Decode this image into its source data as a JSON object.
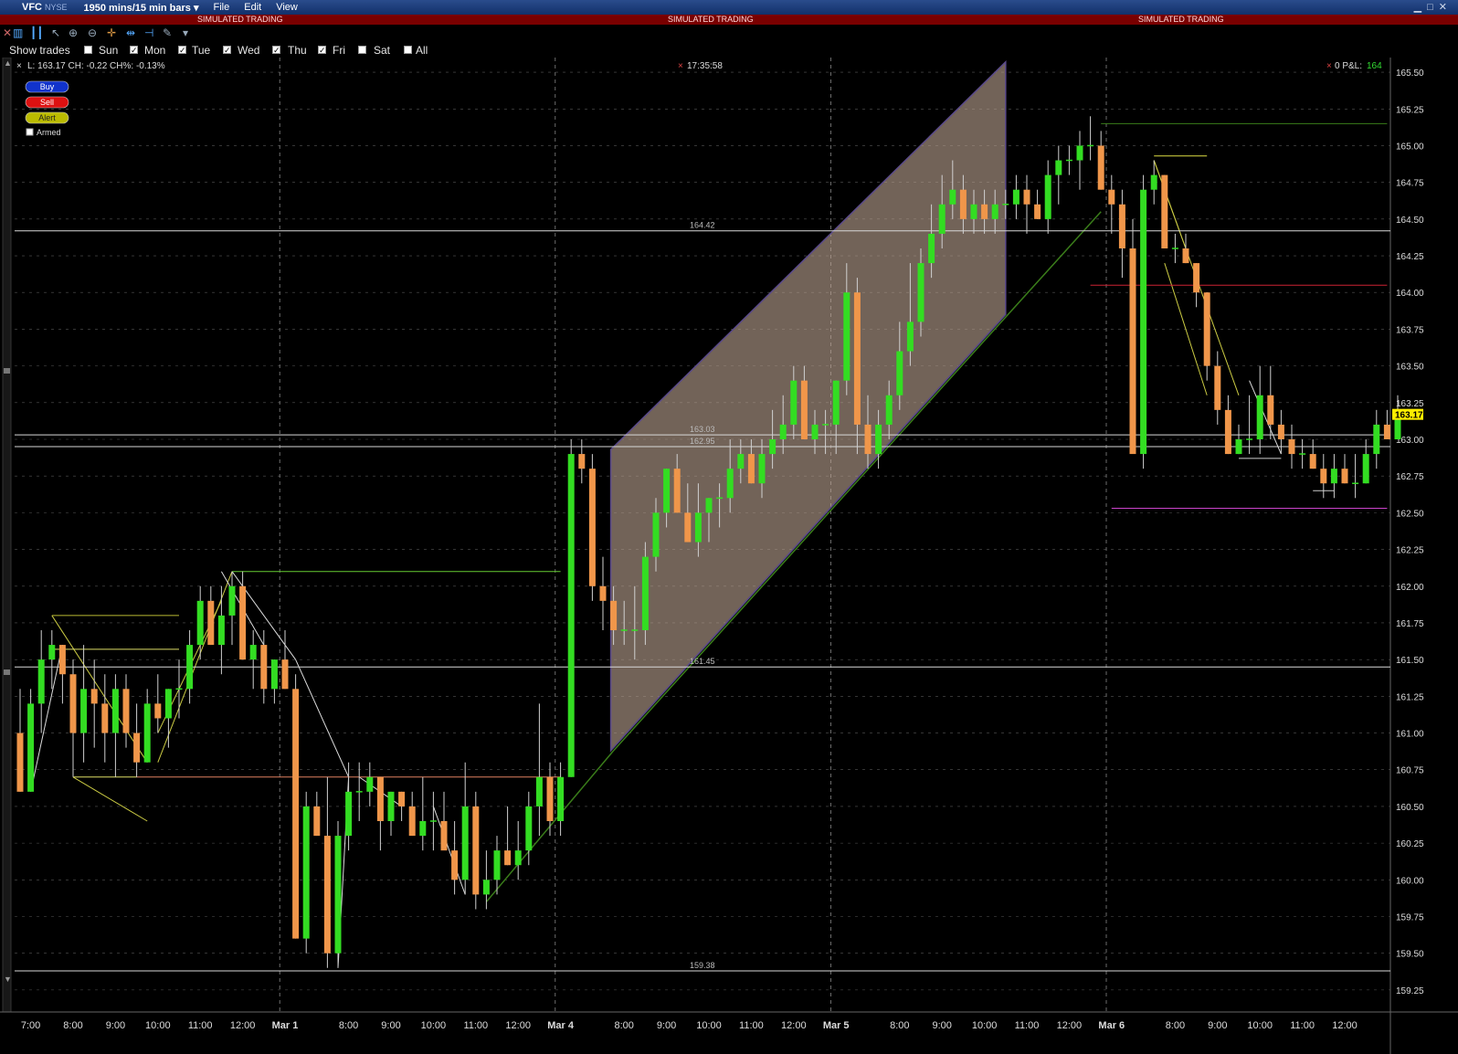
{
  "window": {
    "symbol": "VFC",
    "exchange": "NYSE",
    "period": "1950 mins/15 min bars",
    "menu": [
      "File",
      "Edit",
      "View"
    ],
    "simulated_label": "SIMULATED TRADING"
  },
  "toolbar": {
    "tools": [
      "close-icon",
      "bar-type-icon",
      "bars-icon",
      "cursor-icon",
      "zoom-in-icon",
      "zoom-out-icon",
      "crosshair-icon",
      "pan-icon",
      "ruler-icon",
      "wrench-icon",
      "dropdown-icon"
    ]
  },
  "days": {
    "show_trades_label": "Show trades",
    "items": [
      {
        "label": "Sun",
        "checked": false
      },
      {
        "label": "Mon",
        "checked": true
      },
      {
        "label": "Tue",
        "checked": true
      },
      {
        "label": "Wed",
        "checked": true
      },
      {
        "label": "Thu",
        "checked": true
      },
      {
        "label": "Fri",
        "checked": true
      },
      {
        "label": "Sat",
        "checked": false
      },
      {
        "label": "All",
        "checked": false
      }
    ]
  },
  "info": {
    "quote_line": "L: 163.17 CH: -0.22 CH%: -0.13%",
    "clock": "17:35:58",
    "pnl_prefix": "0 P&L:",
    "pnl_value": "164"
  },
  "order_panel": {
    "buy": "Buy",
    "sell": "Sell",
    "alert": "Alert",
    "armed": "Armed"
  },
  "colors": {
    "up": "#33dd22",
    "down": "#f0964a",
    "channel_fill": "#b8a08e",
    "channel_edge": "#5a4a8a",
    "grid": "#555555",
    "price_badge": "#ffee00"
  },
  "chart_data": {
    "type": "candlestick",
    "ylim": [
      159.1,
      165.6
    ],
    "y_ticks": [
      "165.50",
      "165.25",
      "165.00",
      "164.75",
      "164.50",
      "164.25",
      "164.00",
      "163.75",
      "163.50",
      "163.25",
      "163.00",
      "162.75",
      "162.50",
      "162.25",
      "162.00",
      "161.75",
      "161.50",
      "161.25",
      "161.00",
      "160.75",
      "160.50",
      "160.25",
      "160.00",
      "159.75",
      "159.50",
      "159.25"
    ],
    "last_price": "163.17",
    "x_labels": [
      {
        "label": "7:00",
        "bar": 1
      },
      {
        "label": "8:00",
        "bar": 5
      },
      {
        "label": "9:00",
        "bar": 9
      },
      {
        "label": "10:00",
        "bar": 13
      },
      {
        "label": "11:00",
        "bar": 17
      },
      {
        "label": "12:00",
        "bar": 21
      },
      {
        "label": "Mar 1",
        "bar": 25,
        "bold": true
      },
      {
        "label": "8:00",
        "bar": 31
      },
      {
        "label": "9:00",
        "bar": 35
      },
      {
        "label": "10:00",
        "bar": 39
      },
      {
        "label": "11:00",
        "bar": 43
      },
      {
        "label": "12:00",
        "bar": 47
      },
      {
        "label": "Mar 4",
        "bar": 51,
        "bold": true
      },
      {
        "label": "8:00",
        "bar": 57
      },
      {
        "label": "9:00",
        "bar": 61
      },
      {
        "label": "10:00",
        "bar": 65
      },
      {
        "label": "11:00",
        "bar": 69
      },
      {
        "label": "12:00",
        "bar": 73
      },
      {
        "label": "Mar 5",
        "bar": 77,
        "bold": true
      },
      {
        "label": "8:00",
        "bar": 83
      },
      {
        "label": "9:00",
        "bar": 87
      },
      {
        "label": "10:00",
        "bar": 91
      },
      {
        "label": "11:00",
        "bar": 95
      },
      {
        "label": "12:00",
        "bar": 99
      },
      {
        "label": "Mar 6",
        "bar": 103,
        "bold": true
      },
      {
        "label": "8:00",
        "bar": 109
      },
      {
        "label": "9:00",
        "bar": 113
      },
      {
        "label": "10:00",
        "bar": 117
      },
      {
        "label": "11:00",
        "bar": 121
      },
      {
        "label": "12:00",
        "bar": 125
      }
    ],
    "session_breaks": [
      25,
      51,
      77,
      103
    ],
    "hlines": [
      {
        "price": 164.42,
        "label": "164.42"
      },
      {
        "price": 163.03,
        "label": "163.03"
      },
      {
        "price": 162.95,
        "label": "162.95"
      },
      {
        "price": 161.45,
        "label": "161.45"
      },
      {
        "price": 159.38,
        "label": "159.38"
      }
    ],
    "candles": [
      [
        161.0,
        161.3,
        160.6,
        160.6
      ],
      [
        160.6,
        161.3,
        160.7,
        161.2
      ],
      [
        161.2,
        161.7,
        161.0,
        161.5
      ],
      [
        161.5,
        161.7,
        161.3,
        161.6
      ],
      [
        161.6,
        161.6,
        161.2,
        161.4
      ],
      [
        161.4,
        161.5,
        160.7,
        161.0
      ],
      [
        161.0,
        161.6,
        160.8,
        161.3
      ],
      [
        161.3,
        161.5,
        160.9,
        161.2
      ],
      [
        161.2,
        161.4,
        160.8,
        161.0
      ],
      [
        161.0,
        161.4,
        160.7,
        161.3
      ],
      [
        161.3,
        161.4,
        160.9,
        161.0
      ],
      [
        161.0,
        161.2,
        160.7,
        160.8
      ],
      [
        160.8,
        161.3,
        160.8,
        161.2
      ],
      [
        161.2,
        161.4,
        161.0,
        161.1
      ],
      [
        161.1,
        161.3,
        160.9,
        161.3
      ],
      [
        161.3,
        161.5,
        161.1,
        161.3
      ],
      [
        161.3,
        161.7,
        161.2,
        161.6
      ],
      [
        161.6,
        162.0,
        161.5,
        161.9
      ],
      [
        161.9,
        162.0,
        161.6,
        161.6
      ],
      [
        161.6,
        162.0,
        161.4,
        161.8
      ],
      [
        161.8,
        162.1,
        161.6,
        162.0
      ],
      [
        162.0,
        162.1,
        161.5,
        161.5
      ],
      [
        161.5,
        161.7,
        161.3,
        161.6
      ],
      [
        161.6,
        161.7,
        161.2,
        161.3
      ],
      [
        161.3,
        161.5,
        161.2,
        161.5
      ],
      [
        161.5,
        161.7,
        161.3,
        161.3
      ],
      [
        161.3,
        161.4,
        159.6,
        159.6
      ],
      [
        159.6,
        160.6,
        159.5,
        160.5
      ],
      [
        160.5,
        160.6,
        160.3,
        160.3
      ],
      [
        160.3,
        160.7,
        159.4,
        159.5
      ],
      [
        159.5,
        160.4,
        159.4,
        160.3
      ],
      [
        160.3,
        160.8,
        160.2,
        160.6
      ],
      [
        160.6,
        160.8,
        160.4,
        160.6
      ],
      [
        160.6,
        160.8,
        160.5,
        160.7
      ],
      [
        160.7,
        160.7,
        160.2,
        160.4
      ],
      [
        160.4,
        160.6,
        160.3,
        160.6
      ],
      [
        160.6,
        160.6,
        160.4,
        160.5
      ],
      [
        160.5,
        160.6,
        160.3,
        160.3
      ],
      [
        160.3,
        160.7,
        160.2,
        160.4
      ],
      [
        160.4,
        160.6,
        160.2,
        160.4
      ],
      [
        160.4,
        160.6,
        160.3,
        160.2
      ],
      [
        160.2,
        160.4,
        159.9,
        160.0
      ],
      [
        160.0,
        160.8,
        159.9,
        160.5
      ],
      [
        160.5,
        160.6,
        159.8,
        159.9
      ],
      [
        159.9,
        160.2,
        159.8,
        160.0
      ],
      [
        160.0,
        160.3,
        159.9,
        160.2
      ],
      [
        160.2,
        160.5,
        160.1,
        160.1
      ],
      [
        160.1,
        160.4,
        160.0,
        160.2
      ],
      [
        160.2,
        160.6,
        160.1,
        160.5
      ],
      [
        160.5,
        161.2,
        160.3,
        160.7
      ],
      [
        160.7,
        160.8,
        160.3,
        160.4
      ],
      [
        160.4,
        160.8,
        160.3,
        160.7
      ],
      [
        160.7,
        163.0,
        160.7,
        162.9
      ],
      [
        162.9,
        163.0,
        162.7,
        162.8
      ],
      [
        162.8,
        162.9,
        161.9,
        162.0
      ],
      [
        162.0,
        162.2,
        161.7,
        161.9
      ],
      [
        161.9,
        162.0,
        161.6,
        161.7
      ],
      [
        161.7,
        161.9,
        161.6,
        161.7
      ],
      [
        161.7,
        162.0,
        161.5,
        161.7
      ],
      [
        161.7,
        162.3,
        161.6,
        162.2
      ],
      [
        162.2,
        162.6,
        162.1,
        162.5
      ],
      [
        162.5,
        162.8,
        162.4,
        162.8
      ],
      [
        162.8,
        162.9,
        162.5,
        162.5
      ],
      [
        162.5,
        162.7,
        162.3,
        162.3
      ],
      [
        162.3,
        162.7,
        162.2,
        162.5
      ],
      [
        162.5,
        162.6,
        162.3,
        162.6
      ],
      [
        162.6,
        162.7,
        162.4,
        162.6
      ],
      [
        162.6,
        163.0,
        162.5,
        162.8
      ],
      [
        162.8,
        163.0,
        162.7,
        162.9
      ],
      [
        162.9,
        163.0,
        162.7,
        162.7
      ],
      [
        162.7,
        163.0,
        162.6,
        162.9
      ],
      [
        162.9,
        163.2,
        162.8,
        163.0
      ],
      [
        163.0,
        163.3,
        162.9,
        163.1
      ],
      [
        163.1,
        163.5,
        163.0,
        163.4
      ],
      [
        163.4,
        163.5,
        163.0,
        163.0
      ],
      [
        163.0,
        163.2,
        162.9,
        163.1
      ],
      [
        163.1,
        163.2,
        162.9,
        163.1
      ],
      [
        163.1,
        163.4,
        162.9,
        163.4
      ],
      [
        163.4,
        164.2,
        163.3,
        164.0
      ],
      [
        164.0,
        164.1,
        162.9,
        163.1
      ],
      [
        163.1,
        163.3,
        162.8,
        162.9
      ],
      [
        162.9,
        163.2,
        162.8,
        163.1
      ],
      [
        163.1,
        163.4,
        163.0,
        163.3
      ],
      [
        163.3,
        163.8,
        163.2,
        163.6
      ],
      [
        163.6,
        164.2,
        163.5,
        163.8
      ],
      [
        163.8,
        164.3,
        163.7,
        164.2
      ],
      [
        164.2,
        164.6,
        164.1,
        164.4
      ],
      [
        164.4,
        164.8,
        164.3,
        164.6
      ],
      [
        164.6,
        164.9,
        164.5,
        164.7
      ],
      [
        164.7,
        164.8,
        164.4,
        164.5
      ],
      [
        164.5,
        164.7,
        164.4,
        164.6
      ],
      [
        164.6,
        164.7,
        164.4,
        164.5
      ],
      [
        164.5,
        164.7,
        164.4,
        164.6
      ],
      [
        164.6,
        164.7,
        164.5,
        164.6
      ],
      [
        164.6,
        164.8,
        164.5,
        164.7
      ],
      [
        164.7,
        164.8,
        164.4,
        164.6
      ],
      [
        164.6,
        164.7,
        164.5,
        164.5
      ],
      [
        164.5,
        164.9,
        164.4,
        164.8
      ],
      [
        164.8,
        165.0,
        164.6,
        164.9
      ],
      [
        164.9,
        165.0,
        164.8,
        164.9
      ],
      [
        164.9,
        165.1,
        164.7,
        165.0
      ],
      [
        165.0,
        165.2,
        164.9,
        165.0
      ],
      [
        165.0,
        165.1,
        164.7,
        164.7
      ],
      [
        164.7,
        164.8,
        164.4,
        164.6
      ],
      [
        164.6,
        164.7,
        164.1,
        164.3
      ],
      [
        164.3,
        164.5,
        163.5,
        162.9
      ],
      [
        162.9,
        164.8,
        162.8,
        164.7
      ],
      [
        164.7,
        164.9,
        164.6,
        164.8
      ],
      [
        164.8,
        164.8,
        164.3,
        164.3
      ],
      [
        164.3,
        164.4,
        164.2,
        164.3
      ],
      [
        164.3,
        164.4,
        164.2,
        164.2
      ],
      [
        164.2,
        164.2,
        163.9,
        164.0
      ],
      [
        164.0,
        164.0,
        163.4,
        163.5
      ],
      [
        163.5,
        163.6,
        163.1,
        163.2
      ],
      [
        163.2,
        163.3,
        162.9,
        162.9
      ],
      [
        162.9,
        163.1,
        162.9,
        163.0
      ],
      [
        163.0,
        163.3,
        162.9,
        163.0
      ],
      [
        163.0,
        163.5,
        162.9,
        163.3
      ],
      [
        163.3,
        163.5,
        163.0,
        163.1
      ],
      [
        163.1,
        163.2,
        162.9,
        163.0
      ],
      [
        163.0,
        163.1,
        162.8,
        162.9
      ],
      [
        162.9,
        163.0,
        162.8,
        162.9
      ],
      [
        162.9,
        163.0,
        162.8,
        162.8
      ],
      [
        162.8,
        162.9,
        162.6,
        162.7
      ],
      [
        162.7,
        162.9,
        162.6,
        162.8
      ],
      [
        162.8,
        162.9,
        162.7,
        162.7
      ],
      [
        162.7,
        162.9,
        162.6,
        162.7
      ],
      [
        162.7,
        163.0,
        162.7,
        162.9
      ],
      [
        162.9,
        163.2,
        162.8,
        163.1
      ],
      [
        163.1,
        163.2,
        163.0,
        163.0
      ],
      [
        163.0,
        163.3,
        163.0,
        163.2
      ]
    ]
  }
}
